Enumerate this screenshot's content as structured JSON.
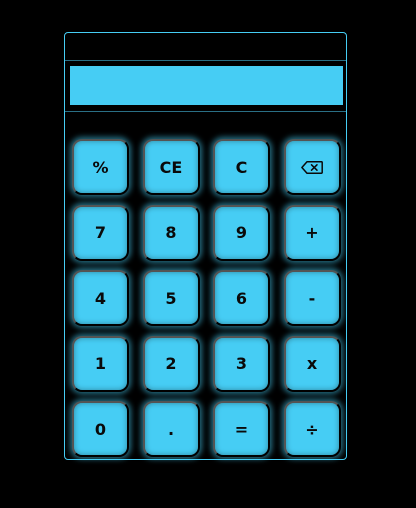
{
  "history": {
    "text": ""
  },
  "display": {
    "value": ""
  },
  "colors": {
    "accent": "#46cdf4",
    "background": "#000000",
    "key_text": "#0a0a0a"
  },
  "keys": [
    {
      "label": "%",
      "name": "percent-key"
    },
    {
      "label": "CE",
      "name": "clear-entry-key"
    },
    {
      "label": "C",
      "name": "clear-key"
    },
    {
      "label": "",
      "name": "backspace-key",
      "icon": "backspace-icon"
    },
    {
      "label": "7",
      "name": "digit-7-key"
    },
    {
      "label": "8",
      "name": "digit-8-key"
    },
    {
      "label": "9",
      "name": "digit-9-key"
    },
    {
      "label": "+",
      "name": "add-key"
    },
    {
      "label": "4",
      "name": "digit-4-key"
    },
    {
      "label": "5",
      "name": "digit-5-key"
    },
    {
      "label": "6",
      "name": "digit-6-key"
    },
    {
      "label": "-",
      "name": "subtract-key"
    },
    {
      "label": "1",
      "name": "digit-1-key"
    },
    {
      "label": "2",
      "name": "digit-2-key"
    },
    {
      "label": "3",
      "name": "digit-3-key"
    },
    {
      "label": "x",
      "name": "multiply-key"
    },
    {
      "label": "0",
      "name": "digit-0-key"
    },
    {
      "label": ".",
      "name": "decimal-key"
    },
    {
      "label": "=",
      "name": "equals-key"
    },
    {
      "label": "÷",
      "name": "divide-key"
    }
  ]
}
